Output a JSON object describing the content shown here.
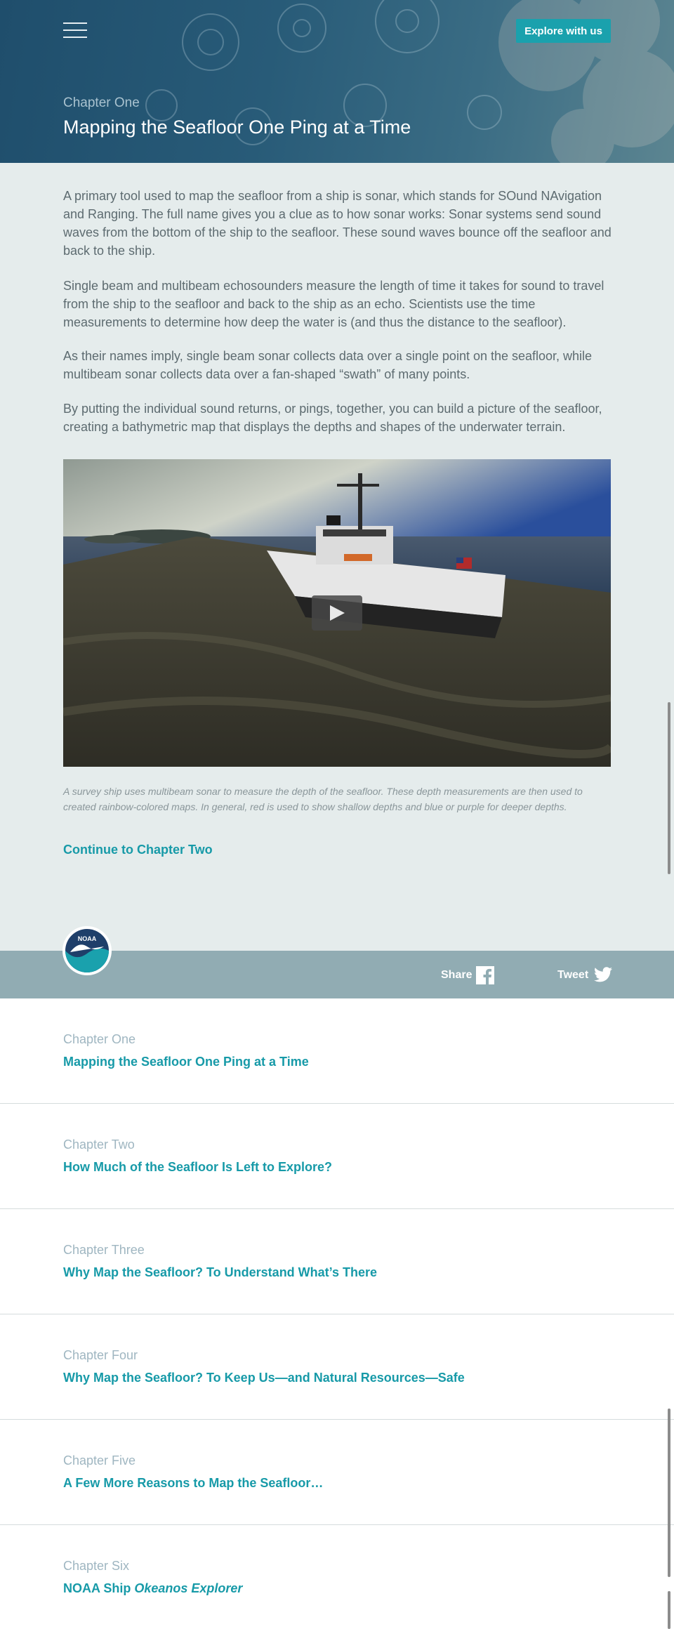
{
  "header": {
    "menu_icon": "hamburger-menu-icon",
    "explore_button": "Explore with us",
    "chapter_kicker": "Chapter One",
    "title": "Mapping the Seafloor One Ping at a Time"
  },
  "article": {
    "paragraph_1": "A primary tool used to map the seafloor from a ship is sonar, which stands for SOund NAvigation and Ranging. The full name gives you a clue as to how sonar works: Sonar systems send sound waves from the bottom of the ship to the seafloor. These sound waves bounce off the seafloor and back to the ship.",
    "paragraph_2": "Single beam and multibeam echosounders measure the length of time it takes for sound to travel from the ship to the seafloor and back to the ship as an echo. Scientists use the time measurements to determine how deep the water is (and thus the distance to the seafloor).",
    "paragraph_3": "As their names imply, single beam sonar collects data over a single point on the seafloor, while multibeam sonar collects data over a fan-shaped “swath” of many points.",
    "paragraph_4": "By putting the individual sound returns, or pings, together, you can build a picture of the seafloor, creating a bathymetric map that displays the depths and shapes of the underwater terrain.",
    "video_play_icon": "play-icon",
    "caption": "A survey ship uses multibeam sonar to measure the depth of the seafloor. These depth measurements are then used to created rainbow-colored maps. In general, red is used to show shallow depths and blue or purple for deeper depths.",
    "continue_link": "Continue to Chapter Two"
  },
  "sharebar": {
    "logo_text": "NOAA",
    "share_label": "Share",
    "share_icon": "facebook-icon",
    "tweet_label": "Tweet",
    "tweet_icon": "twitter-icon"
  },
  "chapters": [
    {
      "number": "Chapter One",
      "title": "Mapping the Seafloor One Ping at a Time"
    },
    {
      "number": "Chapter Two",
      "title": "How Much of the Seafloor Is Left to Explore?"
    },
    {
      "number": "Chapter Three",
      "title": "Why Map the Seafloor? To Understand What’s There"
    },
    {
      "number": "Chapter Four",
      "title": "Why Map the Seafloor? To Keep Us—and Natural Resources—Safe"
    },
    {
      "number": "Chapter Five",
      "title": "A Few More Reasons to Map the Seafloor…"
    },
    {
      "number": "Chapter Six",
      "title_prefix": "NOAA Ship ",
      "title_italic": "Okeanos Explorer"
    }
  ],
  "colors": {
    "accent": "#1aa1ad",
    "link": "#179aa8",
    "hero_bg": "#1f4e6c",
    "article_bg": "#e5ecec",
    "sharebar_bg": "#91acb3"
  }
}
